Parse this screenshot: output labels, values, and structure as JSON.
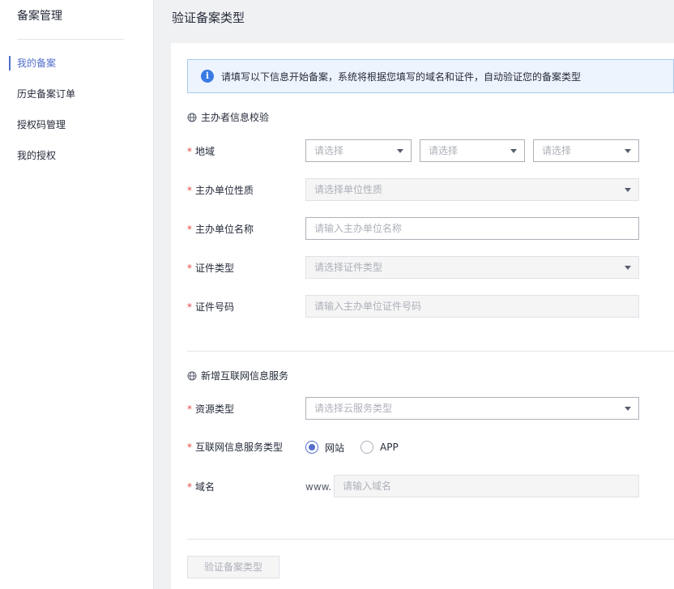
{
  "sidebar": {
    "title": "备案管理",
    "items": [
      {
        "label": "我的备案",
        "active": true
      },
      {
        "label": "历史备案订单",
        "active": false
      },
      {
        "label": "授权码管理",
        "active": false
      },
      {
        "label": "我的授权",
        "active": false
      }
    ]
  },
  "header": {
    "title": "验证备案类型"
  },
  "banner": {
    "icon": "info-icon",
    "text": "请填写以下信息开始备案，系统将根据您填写的域名和证件，自动验证您的备案类型"
  },
  "section1": {
    "heading": "主办者信息校验",
    "region": {
      "label": "地域",
      "selects": [
        "请选择",
        "请选择",
        "请选择"
      ]
    },
    "unit_nature": {
      "label": "主办单位性质",
      "placeholder": "请选择单位性质"
    },
    "unit_name": {
      "label": "主办单位名称",
      "placeholder": "请输入主办单位名称"
    },
    "cert_type": {
      "label": "证件类型",
      "placeholder": "请选择证件类型"
    },
    "cert_number": {
      "label": "证件号码",
      "placeholder": "请输入主办单位证件号码"
    }
  },
  "section2": {
    "heading": "新增互联网信息服务",
    "resource_type": {
      "label": "资源类型",
      "placeholder": "请选择云服务类型"
    },
    "service_type": {
      "label": "互联网信息服务类型",
      "options": [
        "网站",
        "APP"
      ],
      "selected": "网站"
    },
    "domain": {
      "label": "域名",
      "prefix": "www.",
      "placeholder": "请输入域名"
    }
  },
  "actions": {
    "verify_label": "验证备案类型"
  },
  "colors": {
    "accent": "#526ecc",
    "required": "#e54545",
    "info": "#3a7be3"
  }
}
